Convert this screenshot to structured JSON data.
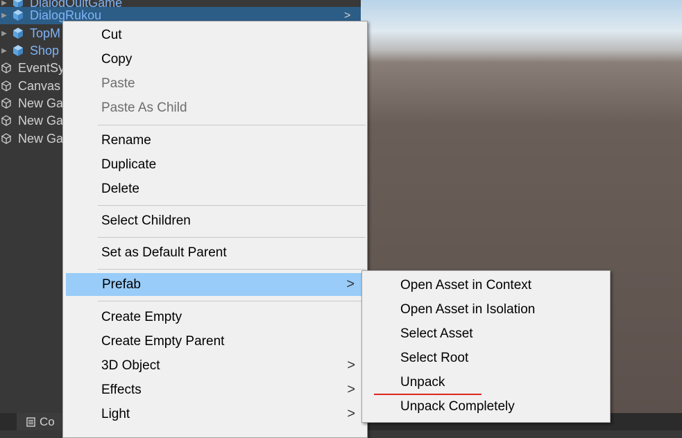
{
  "hierarchy": {
    "rows": [
      {
        "label": "DialogQuitGame",
        "prefab": true
      },
      {
        "label": "DialogRukou",
        "prefab": true
      },
      {
        "label": "TopM",
        "prefab": true
      },
      {
        "label": "Shop",
        "prefab": true
      },
      {
        "label": "EventSy",
        "prefab": false
      },
      {
        "label": "Canvas",
        "prefab": false
      },
      {
        "label": "New Ga",
        "prefab": false
      },
      {
        "label": "New Ga",
        "prefab": false
      },
      {
        "label": "New Ga",
        "prefab": false
      }
    ],
    "expand_arrow": "▶",
    "chevron": ">"
  },
  "bottom": {
    "tab_label": "Co"
  },
  "context_menu": {
    "items": [
      {
        "label": "Cut",
        "enabled": true
      },
      {
        "label": "Copy",
        "enabled": true
      },
      {
        "label": "Paste",
        "enabled": false
      },
      {
        "label": "Paste As Child",
        "enabled": false
      },
      {
        "label": "Rename",
        "enabled": true
      },
      {
        "label": "Duplicate",
        "enabled": true
      },
      {
        "label": "Delete",
        "enabled": true
      },
      {
        "label": "Select Children",
        "enabled": true
      },
      {
        "label": "Set as Default Parent",
        "enabled": true
      },
      {
        "label": "Prefab",
        "enabled": true,
        "submenu": true,
        "highlighted": true
      },
      {
        "label": "Create Empty",
        "enabled": true
      },
      {
        "label": "Create Empty Parent",
        "enabled": true
      },
      {
        "label": "3D Object",
        "enabled": true,
        "submenu": true
      },
      {
        "label": "Effects",
        "enabled": true,
        "submenu": true
      },
      {
        "label": "Light",
        "enabled": true,
        "submenu": true
      }
    ],
    "submenu_arrow": ">"
  },
  "prefab_submenu": {
    "items": [
      {
        "label": "Open Asset in Context"
      },
      {
        "label": "Open Asset in Isolation"
      },
      {
        "label": "Select Asset"
      },
      {
        "label": "Select Root"
      },
      {
        "label": "Unpack",
        "annotated": true
      },
      {
        "label": "Unpack Completely"
      }
    ]
  },
  "colors": {
    "highlight": "#99ccf8",
    "selection": "#2c5d87",
    "prefab_text": "#7fb3f5",
    "annotation": "#e0261e"
  }
}
